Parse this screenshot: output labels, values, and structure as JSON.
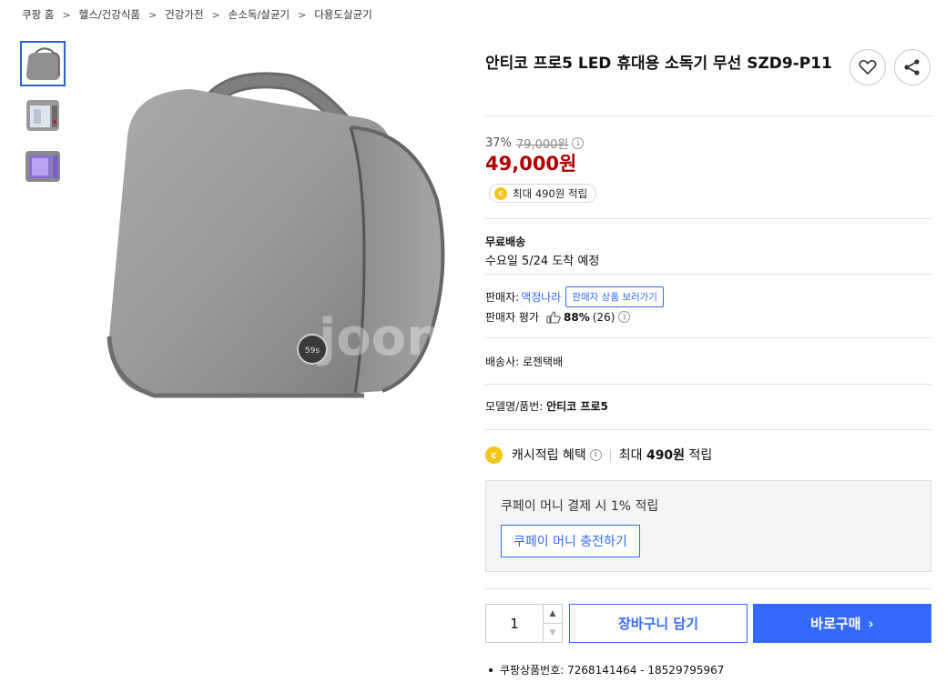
{
  "breadcrumb": [
    "쿠팡 홈",
    "헬스/건강식품",
    "건강가전",
    "손소독/살균기",
    "다용도살균기"
  ],
  "breadcrumb_separator": ">",
  "thumbnails": [
    {
      "name": "gray-bag-thumb",
      "active": true
    },
    {
      "name": "open-bag-thumb",
      "active": false
    },
    {
      "name": "purple-uv-thumb",
      "active": false
    }
  ],
  "main_image": {
    "watermark": "joon",
    "badge_text": "59s"
  },
  "product": {
    "title": "안티코 프로5 LED 휴대용 소독기 무선 SZD9-P11"
  },
  "price": {
    "discount": "37%",
    "original": "79,000원",
    "final": "49,000원",
    "info_icon": "i"
  },
  "cash_pill": {
    "coin": "c",
    "text": "최대 490원 적립"
  },
  "shipping": {
    "title": "무료배송",
    "date": "수요일 5/24 도착 예정"
  },
  "seller": {
    "label": "판매자:",
    "name": "액정나라",
    "other_products": "판매자 상품 보러가기",
    "rating_label": "판매자 평가",
    "rating_pct": "88%",
    "rating_count": "(26)"
  },
  "courier": "배송사: 로젠택배",
  "model": {
    "label": "모델명/품번:",
    "value": "안티코 프로5"
  },
  "cashback": {
    "coin": "c",
    "label": "캐시적립 혜택",
    "prefix": "최대",
    "amount": "490원",
    "suffix": "적립"
  },
  "coupay": {
    "text": "쿠페이 머니 결제 시 1% 적립",
    "button": "쿠페이 머니 충전하기"
  },
  "quantity": {
    "value": "1",
    "up": "▲",
    "down": "▼"
  },
  "actions": {
    "cart": "장바구니 담기",
    "buy": "바로구매",
    "buy_chevron": "›"
  },
  "product_id": "쿠팡상품번호: 7268141464 - 18529795967",
  "colors": {
    "accent": "#346aff",
    "price_red": "#ae0000",
    "coin": "#f5c518"
  }
}
